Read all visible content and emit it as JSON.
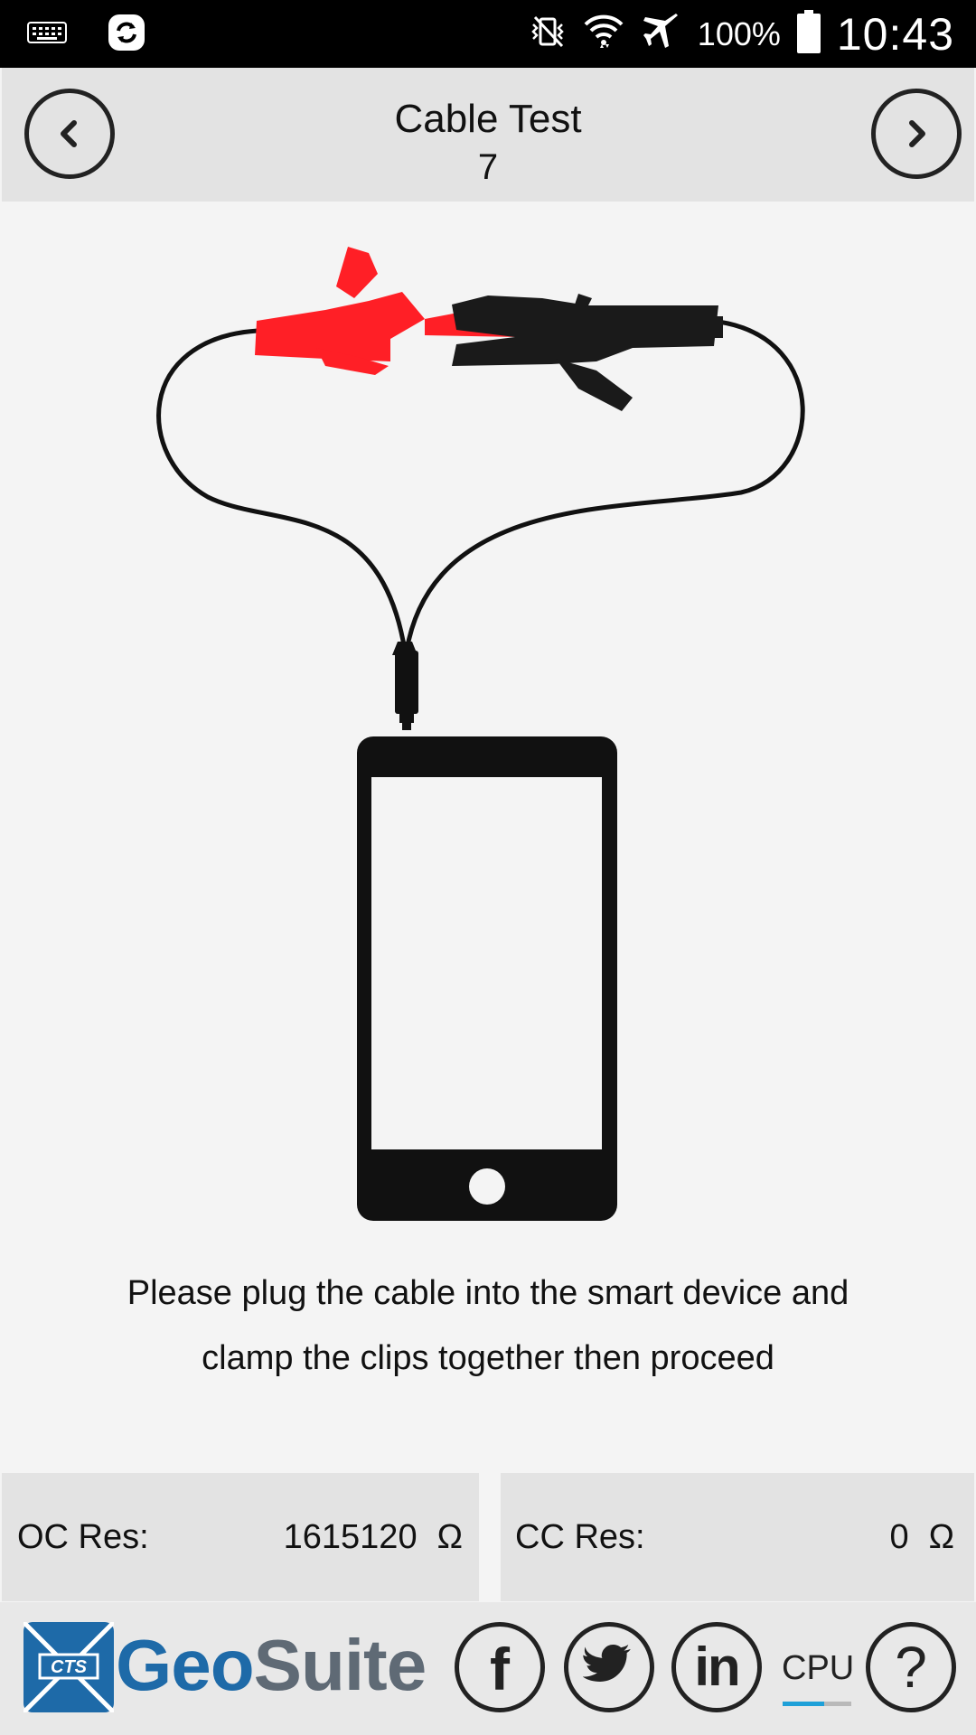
{
  "status_bar": {
    "battery_text": "100%",
    "time": "10:43",
    "icons": [
      "keyboard-icon",
      "sync-icon",
      "vibrate-mute-icon",
      "wifi-icon",
      "airplane-icon",
      "battery-icon"
    ]
  },
  "header": {
    "title": "Cable Test",
    "step": "7",
    "prev_icon": "chevron-left-icon",
    "next_icon": "chevron-right-icon"
  },
  "instruction": "Please plug the cable into the smart device and clamp the clips together then proceed",
  "measurements": {
    "oc": {
      "label": "OC Res:",
      "value": "1615120",
      "unit": "Ω"
    },
    "cc": {
      "label": "CC Res:",
      "value": "0",
      "unit": "Ω"
    }
  },
  "footer": {
    "logo_mark_text": "CTS",
    "logo_geo": "Geo",
    "logo_suite": "Suite",
    "facebook_glyph": "f",
    "linkedin_glyph": "in",
    "help_glyph": "?",
    "cpu_label": "CPU",
    "cpu_load_fraction": 0.6
  },
  "colors": {
    "red_clip": "#ff1f26",
    "black_clip": "#1a1a1a",
    "brand_blue": "#1e6aa8",
    "brand_gray": "#5f6a75",
    "cpu_accent": "#1ea0d8"
  }
}
